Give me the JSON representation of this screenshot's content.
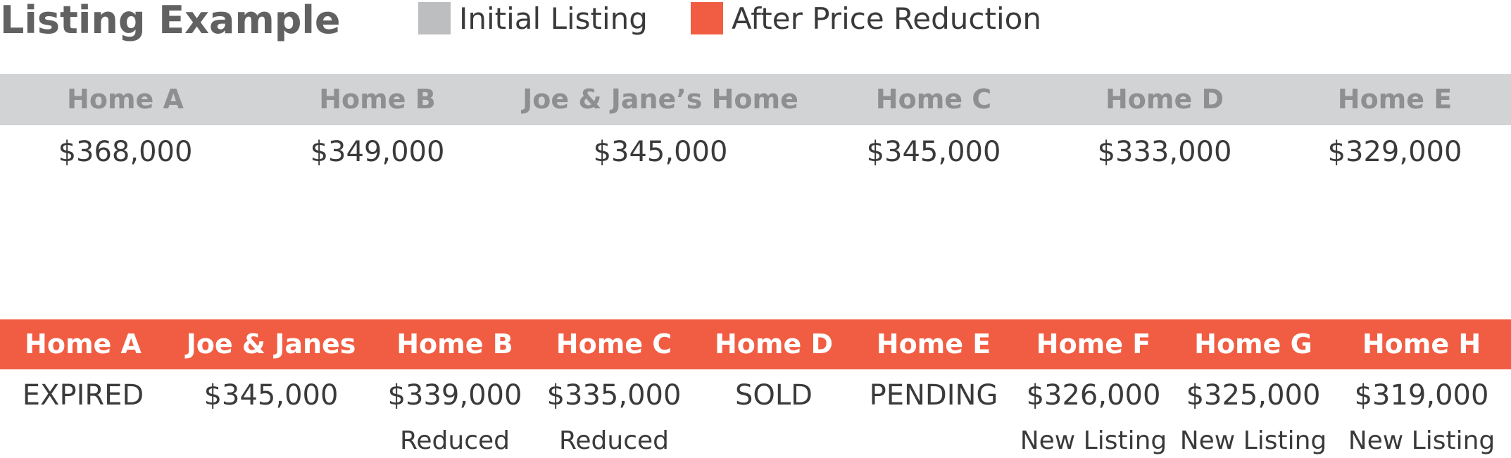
{
  "title": "Listing Example",
  "legend": [
    {
      "label": "Initial Listing",
      "color": "#bdbec0"
    },
    {
      "label": "After Price Reduction",
      "color": "#f15d42"
    }
  ],
  "chart_data": {
    "type": "table",
    "title": "Listing Example",
    "tables": [
      {
        "name": "Initial Listing",
        "color": "#d2d3d5",
        "columns": [
          "Home A",
          "Home B",
          "Joe & Jane’s Home",
          "Home C",
          "Home D",
          "Home E"
        ],
        "prices": [
          "$368,000",
          "$349,000",
          "$345,000",
          "$345,000",
          "$333,000",
          "$329,000"
        ]
      },
      {
        "name": "After Price Reduction",
        "color": "#f15d42",
        "columns": [
          "Home A",
          "Joe & Janes",
          "Home B",
          "Home C",
          "Home D",
          "Home E",
          "Home F",
          "Home G",
          "Home H"
        ],
        "prices": [
          "EXPIRED",
          "$345,000",
          "$339,000",
          "$335,000",
          "SOLD",
          "PENDING",
          "$326,000",
          "$325,000",
          "$319,000"
        ],
        "notes": [
          "",
          "",
          "Reduced",
          "Reduced",
          "",
          "",
          "New Listing",
          "New Listing",
          "New Listing"
        ]
      }
    ]
  }
}
